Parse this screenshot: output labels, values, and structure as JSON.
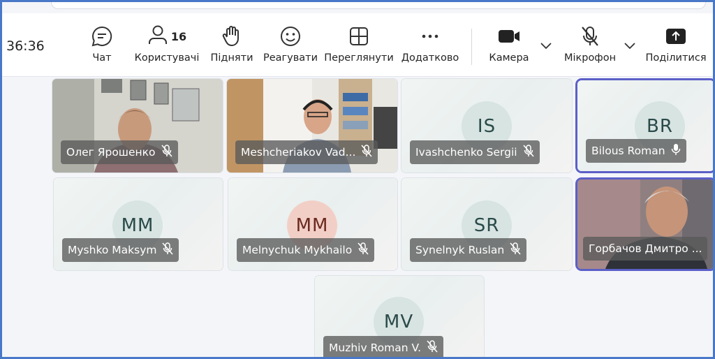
{
  "timer": "36:36",
  "toolbar": {
    "chat": "Чат",
    "people": "Користувачі",
    "people_count": "16",
    "raise": "Підняти",
    "react": "Реагувати",
    "view": "Переглянути",
    "more": "Додатково",
    "camera": "Камера",
    "mic": "Мікрофон",
    "share": "Поділитися"
  },
  "participants": [
    {
      "name": "Олег Ярошенко",
      "video": true
    },
    {
      "name": "Meshcheriakov Vad...",
      "video": true
    },
    {
      "name": "Ivashchenko Sergii",
      "initials": "IS"
    },
    {
      "name": "Bilous Roman",
      "initials": "BR",
      "mic_on": true
    },
    {
      "name": "Myshko Maksym",
      "initials": "MM"
    },
    {
      "name": "Melnychuk Mykhailo",
      "initials": "MM",
      "avatar_color": "#f2cfc6"
    },
    {
      "name": "Synelnyk Ruslan",
      "initials": "SR"
    },
    {
      "name": "Горбачов Дмитро ...",
      "video": true
    },
    {
      "name": "Muzhiv Roman V.",
      "initials": "MV"
    }
  ],
  "colors": {
    "accent": "#5b5fc7",
    "frame": "#4a78c8",
    "avatar": "#d7e4e1"
  }
}
